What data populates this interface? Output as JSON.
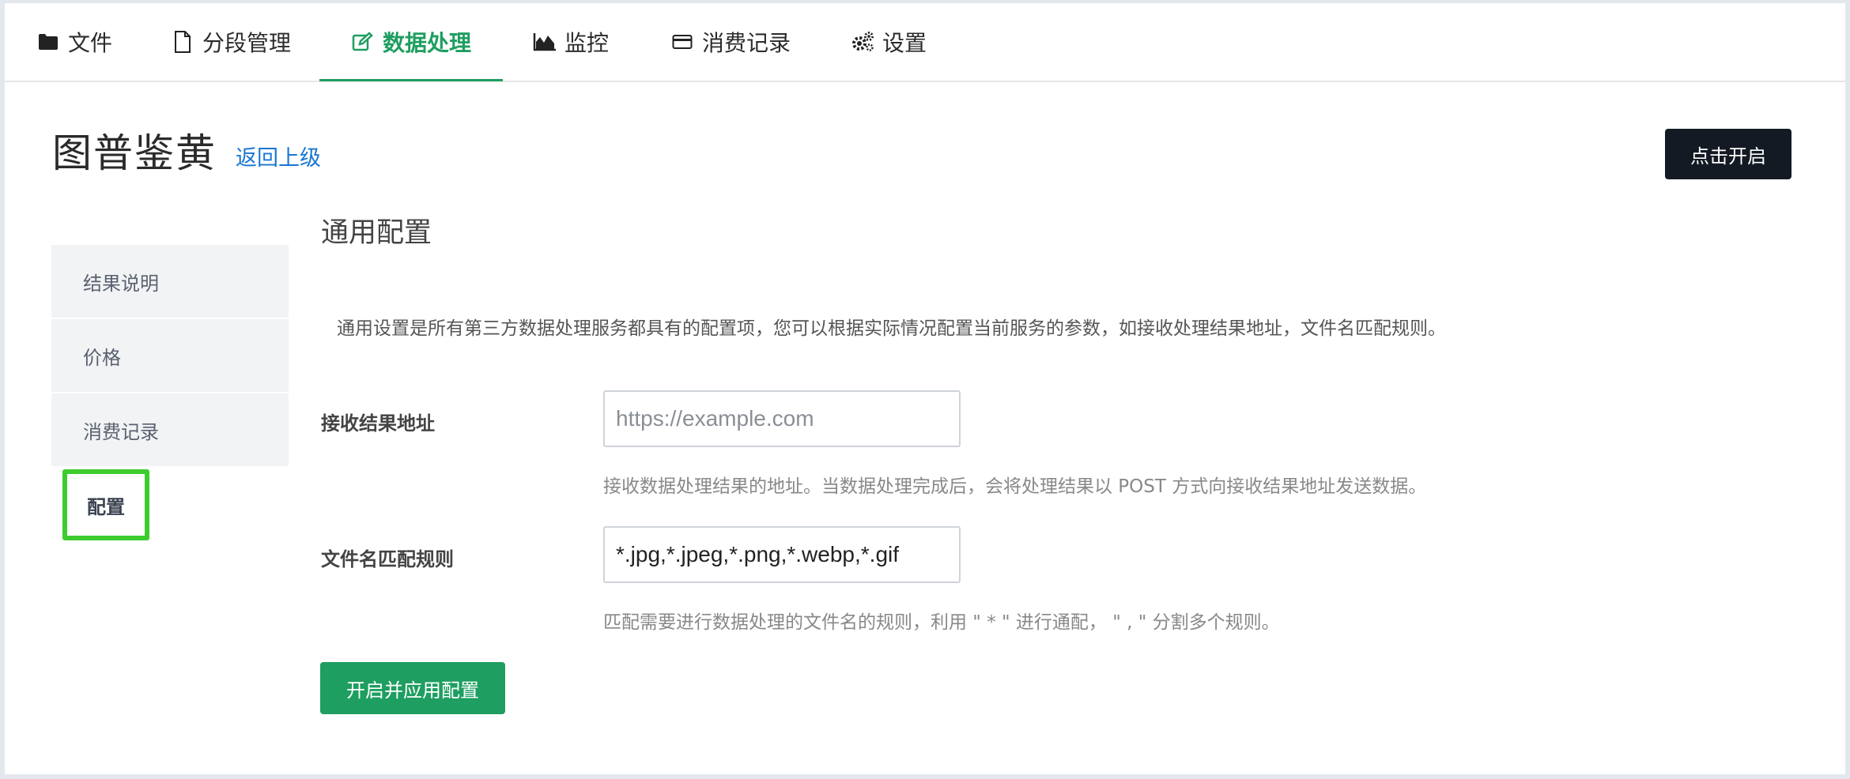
{
  "nav": {
    "tabs": [
      {
        "label": "文件",
        "icon": "folder-icon"
      },
      {
        "label": "分段管理",
        "icon": "file-icon"
      },
      {
        "label": "数据处理",
        "icon": "edit-icon",
        "active": true
      },
      {
        "label": "监控",
        "icon": "area-chart-icon"
      },
      {
        "label": "消费记录",
        "icon": "credit-card-icon"
      },
      {
        "label": "设置",
        "icon": "gears-icon"
      }
    ]
  },
  "header": {
    "title": "图普鉴黄",
    "back_label": "返回上级",
    "start_button": "点击开启"
  },
  "sidebar": {
    "items": [
      {
        "label": "结果说明"
      },
      {
        "label": "价格"
      },
      {
        "label": "消费记录"
      },
      {
        "label": "配置",
        "active": true
      }
    ]
  },
  "main": {
    "section_title": "通用配置",
    "description": "通用设置是所有第三方数据处理服务都具有的配置项，您可以根据实际情况配置当前服务的参数，如接收处理结果地址，文件名匹配规则。",
    "fields": [
      {
        "label": "接收结果地址",
        "value": "",
        "placeholder": "https://example.com",
        "hint": "接收数据处理结果的地址。当数据处理完成后，会将处理结果以 POST 方式向接收结果地址发送数据。"
      },
      {
        "label": "文件名匹配规则",
        "value": "*.jpg,*.jpeg,*.png,*.webp,*.gif",
        "placeholder": "",
        "hint": "匹配需要进行数据处理的文件名的规则，利用 \" * \" 进行通配，  \" , \" 分割多个规则。"
      }
    ],
    "apply_button": "开启并应用配置"
  },
  "colors": {
    "accent": "#1e9e60",
    "link": "#1976d2",
    "dark_button": "#141a24",
    "highlight_box": "#3dcc2f"
  }
}
